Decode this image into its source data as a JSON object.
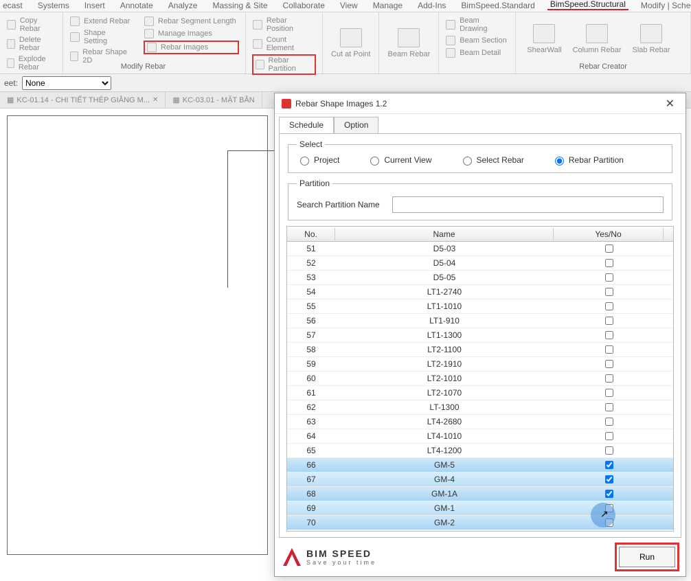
{
  "menubar": {
    "items": [
      "ecast",
      "Systems",
      "Insert",
      "Annotate",
      "Analyze",
      "Massing & Site",
      "Collaborate",
      "View",
      "Manage",
      "Add-Ins",
      "BimSpeed.Standard",
      "BimSpeed.Structural",
      "Modify | Schedule Gra"
    ]
  },
  "ribbon": {
    "modify_rebar": {
      "label": "Modify Rebar",
      "copy": "Copy Rebar",
      "delete": "Delete Rebar",
      "explode": "Explode Rebar",
      "extend": "Extend Rebar",
      "shapeset": "Shape Setting",
      "shape2d": "Rebar Shape 2D",
      "seglen": "Rebar Segment Length",
      "manageimg": "Manage Images",
      "rebarimg": "Rebar Images",
      "rpos": "Rebar Position",
      "count": "Count Element",
      "rpart": "Rebar Partition"
    },
    "cut": "Cut at Point",
    "beamrebar": "Beam Rebar",
    "beam": {
      "drawing": "Beam Drawing",
      "section": "Beam Section",
      "detail": "Beam Detail"
    },
    "creator": {
      "label": "Rebar Creator",
      "shear": "ShearWall",
      "column": "Column Rebar",
      "slab": "Slab Rebar"
    }
  },
  "quickbar": {
    "sheet_label": "eet:",
    "sheet_value": "None"
  },
  "viewtabs": {
    "t1": "KC-01.14 - CHI TIẾT THÉP GIẰNG M...",
    "t2": "KC-03.01 - MẶT BẰN"
  },
  "dialog": {
    "title": "Rebar Shape Images 1.2",
    "tabs": {
      "schedule": "Schedule",
      "option": "Option"
    },
    "select": {
      "legend": "Select",
      "project": "Project",
      "cview": "Current View",
      "srebar": "Select Rebar",
      "rpart": "Rebar Partition"
    },
    "partition": {
      "legend": "Partition",
      "search": "Search Partition Name"
    },
    "table": {
      "columns": {
        "no": "No.",
        "name": "Name",
        "yn": "Yes/No"
      },
      "rows": [
        {
          "no": "51",
          "name": "D5-03",
          "chk": false,
          "sel": ""
        },
        {
          "no": "52",
          "name": "D5-04",
          "chk": false,
          "sel": ""
        },
        {
          "no": "53",
          "name": "D5-05",
          "chk": false,
          "sel": ""
        },
        {
          "no": "54",
          "name": "LT1-2740",
          "chk": false,
          "sel": ""
        },
        {
          "no": "55",
          "name": "LT1-1010",
          "chk": false,
          "sel": ""
        },
        {
          "no": "56",
          "name": "LT1-910",
          "chk": false,
          "sel": ""
        },
        {
          "no": "57",
          "name": "LT1-1300",
          "chk": false,
          "sel": ""
        },
        {
          "no": "58",
          "name": "LT2-1100",
          "chk": false,
          "sel": ""
        },
        {
          "no": "59",
          "name": "LT2-1910",
          "chk": false,
          "sel": ""
        },
        {
          "no": "60",
          "name": "LT2-1010",
          "chk": false,
          "sel": ""
        },
        {
          "no": "61",
          "name": "LT2-1070",
          "chk": false,
          "sel": ""
        },
        {
          "no": "62",
          "name": "LT-1300",
          "chk": false,
          "sel": ""
        },
        {
          "no": "63",
          "name": "LT4-2680",
          "chk": false,
          "sel": ""
        },
        {
          "no": "64",
          "name": "LT4-1010",
          "chk": false,
          "sel": ""
        },
        {
          "no": "65",
          "name": "LT4-1200",
          "chk": false,
          "sel": ""
        },
        {
          "no": "66",
          "name": "GM-5",
          "chk": true,
          "sel": "sel0"
        },
        {
          "no": "67",
          "name": "GM-4",
          "chk": true,
          "sel": "sel1"
        },
        {
          "no": "68",
          "name": "GM-1A",
          "chk": true,
          "sel": "sel0"
        },
        {
          "no": "69",
          "name": "GM-1",
          "chk": false,
          "sel": "sel1"
        },
        {
          "no": "70",
          "name": "GM-2",
          "chk": false,
          "sel": "sel0"
        }
      ]
    },
    "brand": {
      "t1": "BIM SPEED",
      "t2": "Save your time"
    },
    "run": "Run"
  }
}
